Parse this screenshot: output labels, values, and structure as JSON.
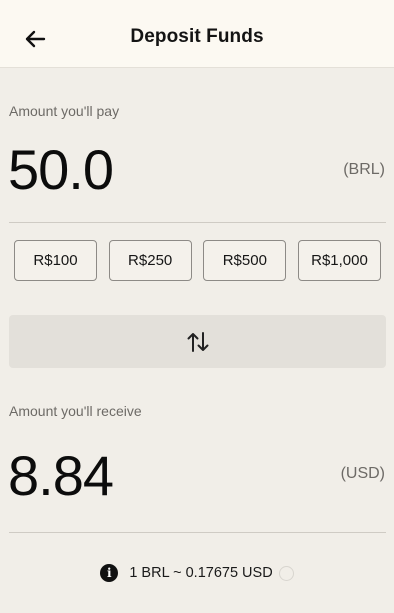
{
  "header": {
    "title": "Deposit Funds",
    "back_icon": "arrow-left-icon"
  },
  "pay": {
    "label": "Amount you'll pay",
    "amount": "50.0",
    "currency": "(BRL)"
  },
  "presets": [
    {
      "label": "R$100"
    },
    {
      "label": "R$250"
    },
    {
      "label": "R$500"
    },
    {
      "label": "R$1,000"
    }
  ],
  "swap": {
    "icon": "swap-vertical-icon"
  },
  "receive": {
    "label": "Amount you'll receive",
    "amount": "8.84",
    "currency": "(USD)"
  },
  "rate": {
    "text": "1 BRL ~ 0.17675 USD",
    "info_icon": "info-icon",
    "refresh_icon": "loading-spinner-icon"
  },
  "colors": {
    "background": "#f1eee8",
    "header_background": "#fcf9f2",
    "swap_button": "#e3e0da",
    "text": "#141414",
    "muted_text": "#6d6a66"
  }
}
